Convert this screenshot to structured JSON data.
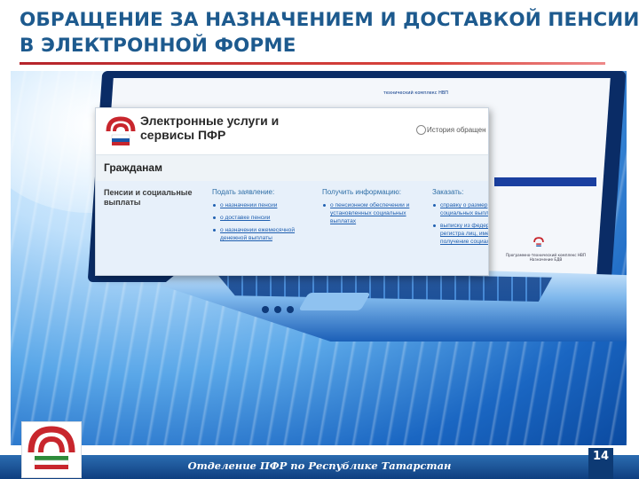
{
  "slide": {
    "title": "ОБРАЩЕНИЕ ЗА НАЗНАЧЕНИЕМ И ДОСТАВКОЙ ПЕНСИИ В ЭЛЕКТРОННОЙ ФОРМЕ",
    "footer": "Отделение ПФР по Республике Татарстан",
    "page_number": "14",
    "accent_color": "#1d5a8e",
    "rule_color": "#b5242b"
  },
  "web_window": {
    "brand": "Электронные услуги и сервисы ПФР",
    "history_link": "История обращен",
    "section": "Гражданам",
    "category": "Пенсии и социальные выплаты",
    "columns": [
      {
        "heading": "Подать заявление:",
        "items": [
          "о назначении пенсии",
          "о доставке пенсии",
          "о назначении ежемесячной денежной выплаты"
        ]
      },
      {
        "heading": "Получить информацию:",
        "items": [
          "о пенсионном обеспечении и установленных социальных выплатах"
        ]
      },
      {
        "heading": "Заказать:",
        "items": [
          "справку о размер социальных выпл",
          "выписку из федер регистра лиц, име получение социал"
        ]
      }
    ]
  },
  "laptop_screen": {
    "top_text": "технический комплекс НВП",
    "caption": "Программно-технический комплекс НВП Назначение ЕДВ"
  },
  "icons": [
    "pfr-logo",
    "history-icon",
    "bullet-icon"
  ]
}
